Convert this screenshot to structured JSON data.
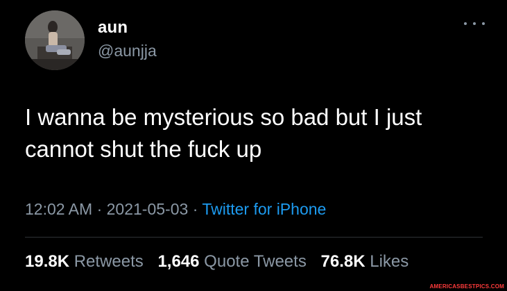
{
  "user": {
    "display_name": "aun",
    "handle": "@aunjja",
    "avatar": "user-avatar-photo"
  },
  "tweet": {
    "text": "I wanna be mysterious so bad but I just cannot shut the fuck up"
  },
  "meta": {
    "time": "12:02 AM",
    "separator": "·",
    "date": "2021-05-03",
    "source": "Twitter for iPhone"
  },
  "stats": {
    "retweets_count": "19.8K",
    "retweets_label": "Retweets",
    "quotes_count": "1,646",
    "quotes_label": "Quote Tweets",
    "likes_count": "76.8K",
    "likes_label": "Likes"
  },
  "icons": {
    "more": "more-options-icon"
  },
  "colors": {
    "background": "#000000",
    "text": "#ffffff",
    "secondary": "#8b98a5",
    "link": "#1d9bf0",
    "divider": "#2f3336"
  },
  "watermark": "AMERICASBESTPICS.COM"
}
